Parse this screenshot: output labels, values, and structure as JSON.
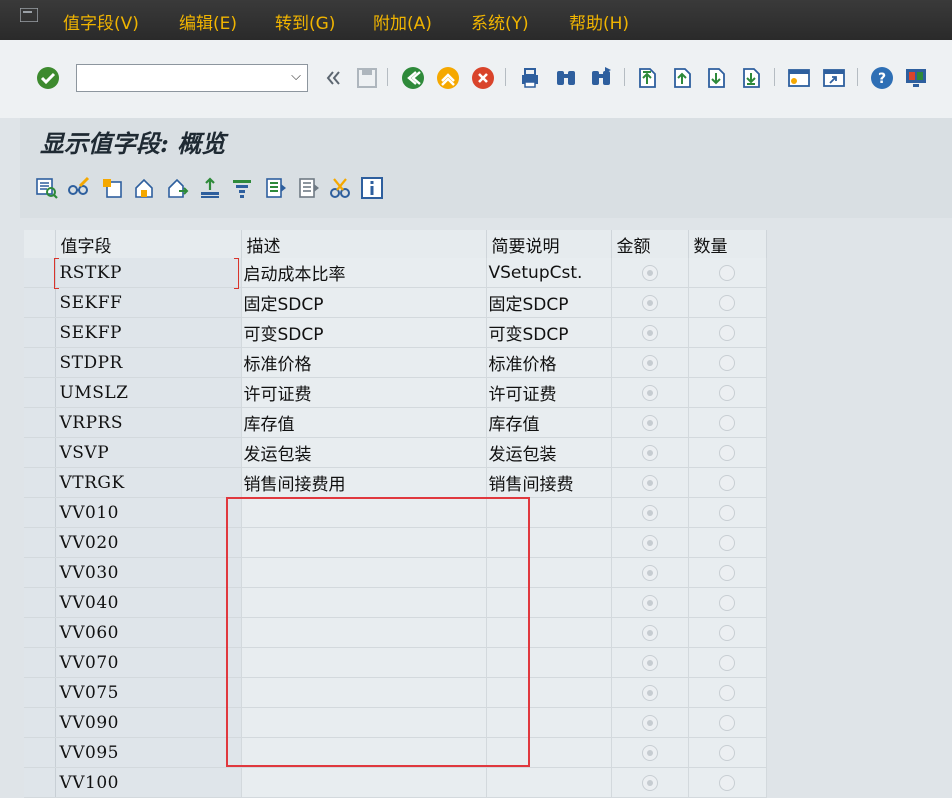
{
  "menu": {
    "items": [
      {
        "label": "值字段(V)"
      },
      {
        "label": "编辑(E)"
      },
      {
        "label": "转到(G)"
      },
      {
        "label": "附加(A)"
      },
      {
        "label": "系统(Y)"
      },
      {
        "label": "帮助(H)"
      }
    ]
  },
  "toolbar": {
    "command_field_value": "",
    "icons": [
      "enter-icon",
      "back-icon",
      "exit-icon",
      "cancel-icon",
      "print-icon",
      "find-icon",
      "find-next-icon",
      "first-page-icon",
      "previous-page-icon",
      "next-page-icon",
      "last-page-icon",
      "create-session-icon",
      "shortcut-icon",
      "help-icon",
      "layout-icon"
    ],
    "colors": {
      "accent": "#f0b400",
      "menubar": "#2e2e2e"
    }
  },
  "page": {
    "title": "显示值字段: 概览"
  },
  "app_toolbar": {
    "icons": [
      "details-icon",
      "edit-glasses-icon",
      "new-entries-icon",
      "copy-icon",
      "move-icon",
      "sort-ascending-icon",
      "filter-icon",
      "select-all-icon",
      "deselect-all-icon",
      "cut-icon",
      "info-icon"
    ]
  },
  "table": {
    "columns": [
      "值字段",
      "描述",
      "简要说明",
      "金额",
      "数量"
    ],
    "rows": [
      {
        "field": "RSTKP",
        "desc": "启动成本比率",
        "short": "VSetupCst.",
        "amount": true,
        "qty": false
      },
      {
        "field": "SEKFF",
        "desc": "固定SDCP",
        "short": "固定SDCP",
        "amount": true,
        "qty": false
      },
      {
        "field": "SEKFP",
        "desc": "可变SDCP",
        "short": "可变SDCP",
        "amount": true,
        "qty": false
      },
      {
        "field": "STDPR",
        "desc": "标准价格",
        "short": "标准价格",
        "amount": true,
        "qty": false
      },
      {
        "field": "UMSLZ",
        "desc": "许可证费",
        "short": "许可证费",
        "amount": true,
        "qty": false
      },
      {
        "field": "VRPRS",
        "desc": "库存值",
        "short": "库存值",
        "amount": true,
        "qty": false
      },
      {
        "field": "VSVP",
        "desc": "发运包装",
        "short": "发运包装",
        "amount": true,
        "qty": false
      },
      {
        "field": "VTRGK",
        "desc": "销售间接费用",
        "short": "销售间接费",
        "amount": true,
        "qty": false
      },
      {
        "field": "VV010",
        "desc": "",
        "short": "",
        "amount": true,
        "qty": false
      },
      {
        "field": "VV020",
        "desc": "",
        "short": "",
        "amount": true,
        "qty": false
      },
      {
        "field": "VV030",
        "desc": "",
        "short": "",
        "amount": true,
        "qty": false
      },
      {
        "field": "VV040",
        "desc": "",
        "short": "",
        "amount": true,
        "qty": false
      },
      {
        "field": "VV060",
        "desc": "",
        "short": "",
        "amount": true,
        "qty": false
      },
      {
        "field": "VV070",
        "desc": "",
        "short": "",
        "amount": true,
        "qty": false
      },
      {
        "field": "VV075",
        "desc": "",
        "short": "",
        "amount": true,
        "qty": false
      },
      {
        "field": "VV090",
        "desc": "",
        "short": "",
        "amount": true,
        "qty": false
      },
      {
        "field": "VV095",
        "desc": "",
        "short": "",
        "amount": true,
        "qty": false
      },
      {
        "field": "VV100",
        "desc": "",
        "short": "",
        "amount": true,
        "qty": false
      }
    ]
  }
}
